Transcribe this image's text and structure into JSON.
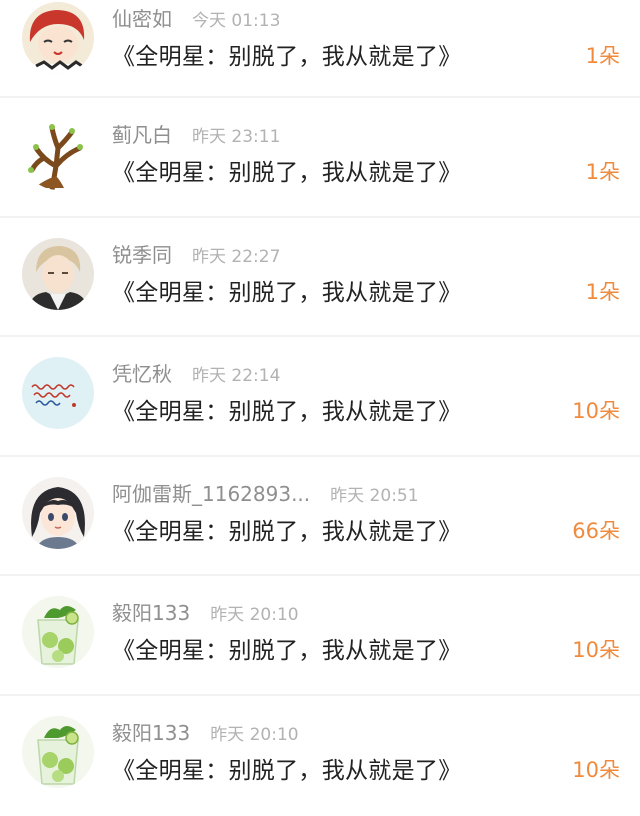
{
  "items": [
    {
      "name": "仙密如",
      "time": "今天 01:13",
      "title": "《全明星：别脱了，我从就是了》",
      "count": "1朵",
      "avatar": "red-hair-girl-avatar"
    },
    {
      "name": "蓟凡白",
      "time": "昨天 23:11",
      "title": "《全明星：别脱了，我从就是了》",
      "count": "1朵",
      "avatar": "tree-branch-avatar"
    },
    {
      "name": "锐季同",
      "time": "昨天 22:27",
      "title": "《全明星：别脱了，我从就是了》",
      "count": "1朵",
      "avatar": "anime-boy-avatar"
    },
    {
      "name": "凭忆秋",
      "time": "昨天 22:14",
      "title": "《全明星：别脱了，我从就是了》",
      "count": "10朵",
      "avatar": "handwriting-avatar"
    },
    {
      "name": "阿伽雷斯_1162893...",
      "time": "昨天 20:51",
      "title": "《全明星：别脱了，我从就是了》",
      "count": "66朵",
      "avatar": "dark-hair-girl-avatar"
    },
    {
      "name": "毅阳133",
      "time": "昨天 20:10",
      "title": "《全明星：别脱了，我从就是了》",
      "count": "10朵",
      "avatar": "mojito-drink-avatar"
    },
    {
      "name": "毅阳133",
      "time": "昨天 20:10",
      "title": "《全明星：别脱了，我从就是了》",
      "count": "10朵",
      "avatar": "mojito-drink-avatar"
    }
  ],
  "colors": {
    "count": "#f08a3c",
    "name": "#8f8f8f",
    "time": "#b2b2b2",
    "title": "#222222"
  }
}
